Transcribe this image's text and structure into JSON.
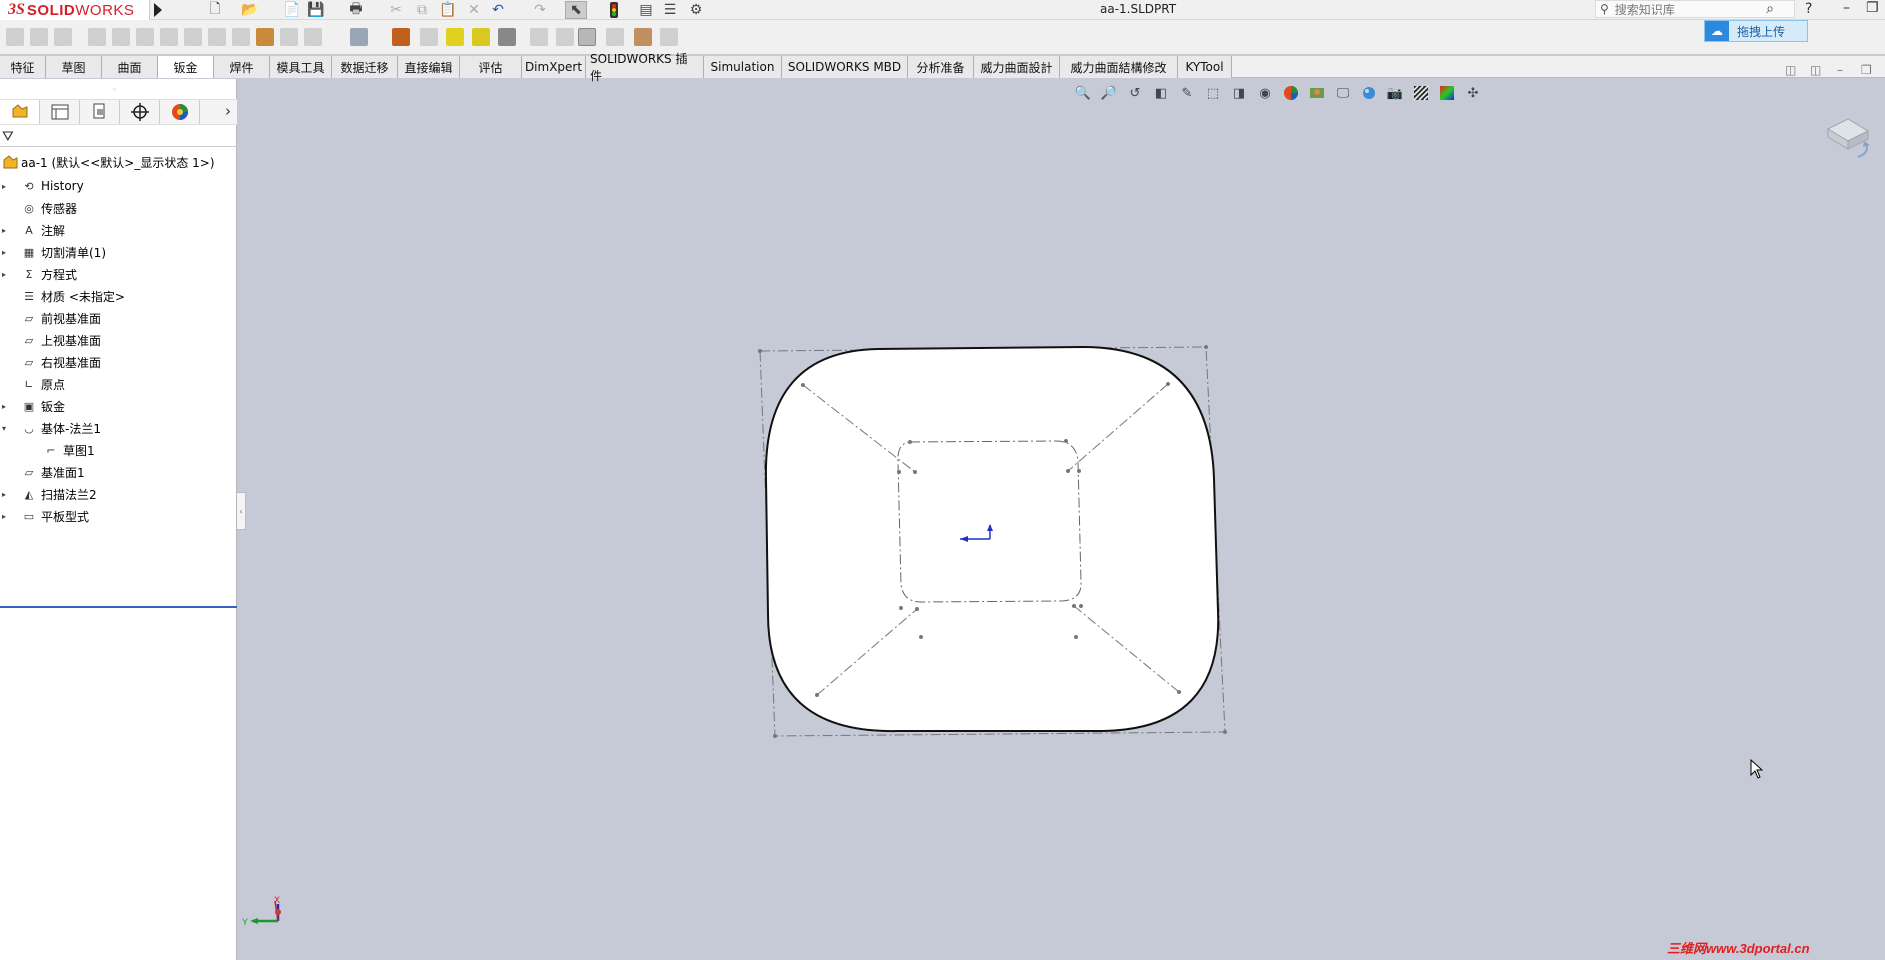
{
  "app": {
    "brand_ds": "3S",
    "brand_name_bold": "SOLID",
    "brand_name_light": "WORKS",
    "window_title": "aa-1.SLDPRT",
    "search_placeholder": "搜索知识库",
    "upload_label": "拖拽上传",
    "help_glyph": "?"
  },
  "tabs": [
    {
      "label": "特征",
      "active": false
    },
    {
      "label": "草图",
      "active": false
    },
    {
      "label": "曲面",
      "active": false
    },
    {
      "label": "钣金",
      "active": true
    },
    {
      "label": "焊件",
      "active": false
    },
    {
      "label": "模具工具",
      "active": false
    },
    {
      "label": "数据迁移",
      "active": false
    },
    {
      "label": "直接编辑",
      "active": false
    },
    {
      "label": "评估",
      "active": false
    },
    {
      "label": "DimXpert",
      "active": false
    },
    {
      "label": "SOLIDWORKS 插件",
      "active": false
    },
    {
      "label": "Simulation",
      "active": false
    },
    {
      "label": "SOLIDWORKS MBD",
      "active": false
    },
    {
      "label": "分析准备",
      "active": false
    },
    {
      "label": "威力曲面設計",
      "active": false
    },
    {
      "label": "威力曲面結構修改",
      "active": false
    },
    {
      "label": "KYTool",
      "active": false
    }
  ],
  "feature_tree": {
    "root_label": "aa-1 (默认<<默认>_显示状态 1>)",
    "items": [
      {
        "label": "History",
        "icon": "history-icon",
        "expandable": true,
        "child": false
      },
      {
        "label": "传感器",
        "icon": "sensor-icon",
        "expandable": false,
        "child": false
      },
      {
        "label": "注解",
        "icon": "annotation-icon",
        "expandable": true,
        "child": false
      },
      {
        "label": "切割清单(1)",
        "icon": "cut-list-icon",
        "expandable": true,
        "child": false
      },
      {
        "label": "方程式",
        "icon": "equation-icon",
        "expandable": true,
        "child": false
      },
      {
        "label": "材质 <未指定>",
        "icon": "material-icon",
        "expandable": false,
        "child": false
      },
      {
        "label": "前视基准面",
        "icon": "plane-icon",
        "expandable": false,
        "child": false
      },
      {
        "label": "上视基准面",
        "icon": "plane-icon",
        "expandable": false,
        "child": false
      },
      {
        "label": "右视基准面",
        "icon": "plane-icon",
        "expandable": false,
        "child": false
      },
      {
        "label": "原点",
        "icon": "origin-icon",
        "expandable": false,
        "child": false
      },
      {
        "label": "钣金",
        "icon": "sheet-metal-icon",
        "expandable": true,
        "child": false
      },
      {
        "label": "基体-法兰1",
        "icon": "base-flange-icon",
        "expandable": true,
        "child": false
      },
      {
        "label": "草图1",
        "icon": "sketch-icon",
        "expandable": false,
        "child": true
      },
      {
        "label": "基准面1",
        "icon": "plane-icon",
        "expandable": false,
        "child": false
      },
      {
        "label": "扫描法兰2",
        "icon": "swept-flange-icon",
        "expandable": true,
        "child": false
      },
      {
        "label": "平板型式",
        "icon": "flat-pattern-icon",
        "expandable": true,
        "child": false
      }
    ]
  },
  "triad": {
    "x_label": "X",
    "y_label": "Y"
  },
  "watermark": "三维网www.3dportal.cn",
  "colors": {
    "viewport_bg": "#c5cad6",
    "accent_blue": "#3a5fbf",
    "brand_red": "#d4202a"
  }
}
